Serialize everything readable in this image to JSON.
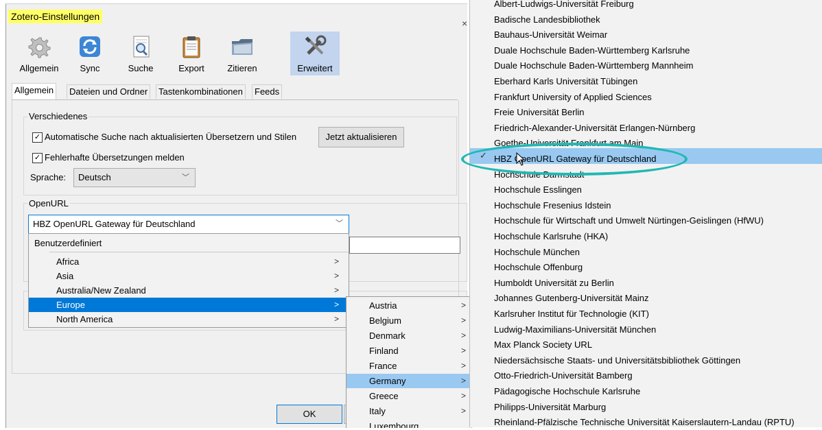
{
  "window": {
    "title": "Zotero-Einstellungen",
    "close_glyph": "×",
    "toolbar": [
      {
        "label": "Allgemein",
        "icon": "gear-icon"
      },
      {
        "label": "Sync",
        "icon": "sync-icon"
      },
      {
        "label": "Suche",
        "icon": "search-icon"
      },
      {
        "label": "Export",
        "icon": "clipboard-icon"
      },
      {
        "label": "Zitieren",
        "icon": "folder-icon"
      },
      {
        "label": "Erweitert",
        "icon": "tools-icon"
      }
    ],
    "tabs": [
      "Allgemein",
      "Dateien und Ordner",
      "Tastenkombinationen",
      "Feeds"
    ]
  },
  "misc": {
    "group_title": "Verschiedenes",
    "auto_update_label": "Automatische Suche nach aktualisierten Übersetzern und Stilen",
    "update_now_button": "Jetzt aktualisieren",
    "report_broken_label": "Fehlerhafte Übersetzungen melden",
    "language_label": "Sprache:",
    "language_value": "Deutsch"
  },
  "openurl": {
    "group_title": "OpenURL",
    "resolver_value": "HBZ OpenURL Gateway für Deutschland"
  },
  "resolver_menu": {
    "custom": "Benutzerdefiniert",
    "regions": [
      "Africa",
      "Asia",
      "Australia/New Zealand",
      "Europe",
      "North America"
    ],
    "submenu_arrow": ">"
  },
  "country_menu": {
    "countries": [
      "Austria",
      "Belgium",
      "Denmark",
      "Finland",
      "France",
      "Germany",
      "Greece",
      "Italy",
      "Luxembourg"
    ]
  },
  "ok_button": "OK",
  "institution_menu": {
    "items": [
      "Albert-Ludwigs-Universität Freiburg",
      "Badische Landesbibliothek",
      "Bauhaus-Universität Weimar",
      "Duale Hochschule Baden-Württemberg Karlsruhe",
      "Duale Hochschule Baden-Württemberg Mannheim",
      "Eberhard Karls Universität Tübingen",
      "Frankfurt University of Applied Sciences",
      "Freie Universität Berlin",
      "Friedrich-Alexander-Universität Erlangen-Nürnberg",
      "Goethe-Universität Frankfurt am Main",
      "HBZ OpenURL Gateway für Deutschland",
      "Hochschule Darmstadt",
      "Hochschule Esslingen",
      "Hochschule Fresenius Idstein",
      "Hochschule für Wirtschaft und Umwelt Nürtingen-Geislingen (HfWU)",
      "Hochschule Karlsruhe (HKA)",
      "Hochschule München",
      "Hochschule Offenburg",
      "Humboldt Universität zu Berlin",
      "Johannes Gutenberg-Universität Mainz",
      "Karlsruher Institut für Technologie (KIT)",
      "Ludwig-Maximilians-Universität München",
      "Max Planck Society URL",
      "Niedersächsische Staats- und Universitätsbibliothek Göttingen",
      "Otto-Friedrich-Universität Bamberg",
      "Pädagogische Hochschule Karlsruhe",
      "Philipps-Universität Marburg",
      "Rheinland-Pfälzische Technische Universität Kaiserslautern-Landau (RPTU)"
    ],
    "selected_index": 10,
    "check_glyph": "✓"
  },
  "colors": {
    "highlight_yellow": "#ffff66",
    "menu_selected": "#0078d7",
    "menu_hover": "#99c9f1",
    "callout": "#21b8b3"
  }
}
